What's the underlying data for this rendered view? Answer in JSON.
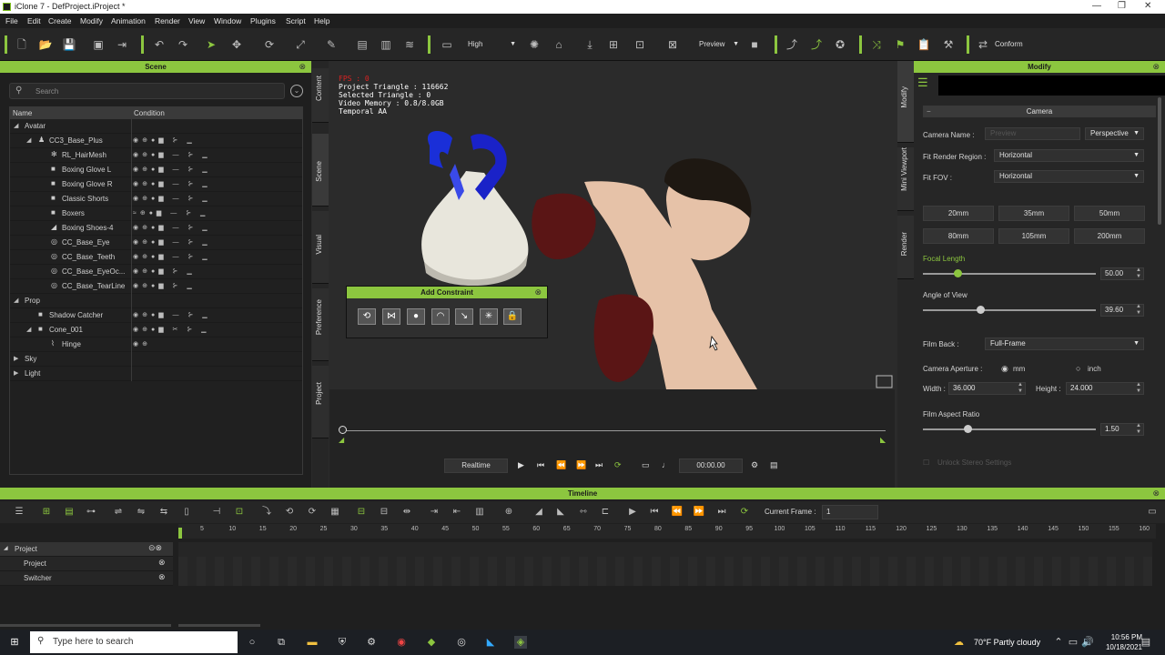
{
  "window": {
    "title": "iClone 7 - DefProject.iProject *"
  },
  "menu": [
    "File",
    "Edit",
    "Create",
    "Modify",
    "Animation",
    "Render",
    "View",
    "Window",
    "Plugins",
    "Script",
    "Help"
  ],
  "toolbar": {
    "quality": "High",
    "view_mode": "Preview",
    "conform": "Conform"
  },
  "scene": {
    "title": "Scene",
    "search_placeholder": "Search",
    "col_name": "Name",
    "col_condition": "Condition",
    "items": [
      {
        "label": "Avatar"
      },
      {
        "label": "CC3_Base_Plus"
      },
      {
        "label": "RL_HairMesh"
      },
      {
        "label": "Boxing Glove L"
      },
      {
        "label": "Boxing Glove R"
      },
      {
        "label": "Classic Shorts"
      },
      {
        "label": "Boxers"
      },
      {
        "label": "Boxing Shoes-4"
      },
      {
        "label": "CC_Base_Eye"
      },
      {
        "label": "CC_Base_Teeth"
      },
      {
        "label": "CC_Base_EyeOc..."
      },
      {
        "label": "CC_Base_TearLine"
      },
      {
        "label": "Prop"
      },
      {
        "label": "Shadow Catcher"
      },
      {
        "label": "Cone_001"
      },
      {
        "label": "Hinge"
      },
      {
        "label": "Sky"
      },
      {
        "label": "Light"
      }
    ]
  },
  "side_tabs": [
    "Content",
    "Scene",
    "Visual",
    "Preference",
    "Project"
  ],
  "right_tabs": [
    "Modify",
    "Mini Viewport",
    "Render"
  ],
  "viewport": {
    "fps": "FPS : 0",
    "stats": [
      "Project Triangle : 116662",
      "Selected Triangle : 0",
      "Video Memory : 0.8/8.0GB",
      "Temporal AA"
    ]
  },
  "constraint": {
    "title": "Add Constraint"
  },
  "playback": {
    "mode": "Realtime",
    "time": "00:00.00"
  },
  "modify": {
    "title": "Modify",
    "section": "Camera",
    "camera_name_label": "Camera Name :",
    "camera_name_value": "Preview",
    "projection": "Perspective",
    "fit_render_region_label": "Fit Render Region :",
    "fit_render_region": "Horizontal",
    "fit_fov_label": "Fit FOV :",
    "fit_fov": "Horizontal",
    "lens_buttons": [
      "20mm",
      "35mm",
      "50mm",
      "80mm",
      "105mm",
      "200mm"
    ],
    "focal_length_label": "Focal Length",
    "focal_length": "50.00",
    "focal_length_fraction": 0.2,
    "angle_of_view_label": "Angle of View",
    "angle_of_view": "39.60",
    "angle_of_view_fraction": 0.33,
    "film_back_label": "Film Back :",
    "film_back": "Full-Frame",
    "camera_aperture_label": "Camera Aperture :",
    "aperture_unit_mm": "mm",
    "aperture_unit_inch": "inch",
    "width_label": "Width :",
    "width_value": "36.000",
    "height_label": "Height :",
    "height_value": "24.000",
    "film_aspect_label": "Film Aspect Ratio",
    "film_aspect": "1.50",
    "film_aspect_fraction": 0.26,
    "unlock_stereo": "Unlock Stereo Settings"
  },
  "timeline": {
    "title": "Timeline",
    "current_frame_label": "Current Frame :",
    "current_frame": "1",
    "ruler": [
      "5",
      "10",
      "15",
      "20",
      "25",
      "30",
      "35",
      "40",
      "45",
      "50",
      "55",
      "60",
      "65",
      "70",
      "75",
      "80",
      "85",
      "90",
      "95",
      "100",
      "105",
      "110",
      "115",
      "120",
      "125",
      "130",
      "135",
      "140",
      "145",
      "150",
      "155",
      "160"
    ],
    "tracks": [
      {
        "label": "Project"
      },
      {
        "label": "Project"
      },
      {
        "label": "Switcher"
      }
    ]
  },
  "taskbar": {
    "search_placeholder": "Type here to search",
    "weather": "70°F  Partly cloudy",
    "time": "10:56 PM",
    "date": "10/18/2021"
  }
}
